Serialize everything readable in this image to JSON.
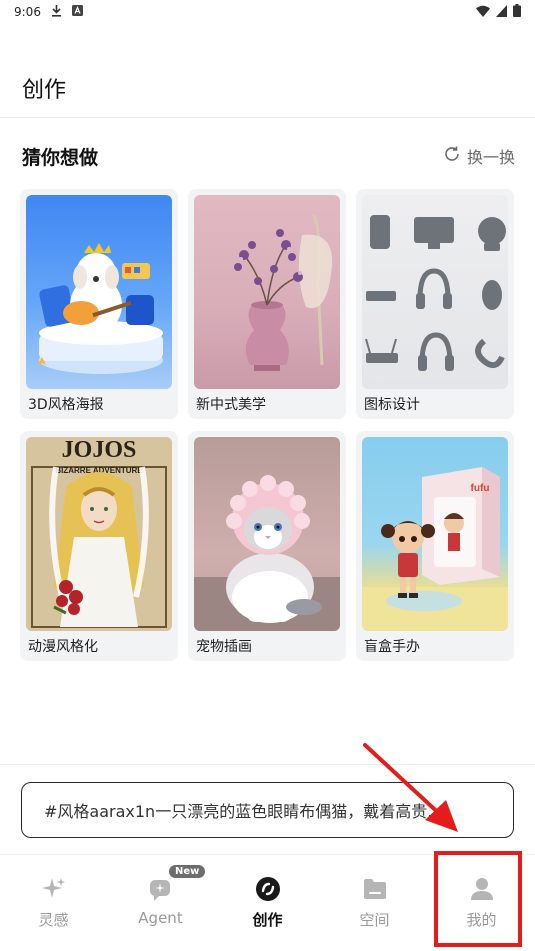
{
  "status_bar": {
    "time": "9:06"
  },
  "header": {
    "title": "创作"
  },
  "suggest": {
    "title": "猜你想做",
    "refresh_label": "换一换",
    "cards": [
      {
        "label": "3D风格海报"
      },
      {
        "label": "新中式美学"
      },
      {
        "label": "图标设计"
      },
      {
        "label": "动漫风格化"
      },
      {
        "label": "宠物插画"
      },
      {
        "label": "盲盒手办"
      }
    ],
    "poster_text": {
      "title": "JOJOS",
      "subtitle": "BIZARRE ADVENTURE",
      "box_brand": "fufu"
    }
  },
  "prompt": {
    "text": "#风格aarax1n一只漂亮的蓝色眼睛布偶猫，戴着高贵..."
  },
  "tabbar": {
    "items": [
      {
        "label": "灵感",
        "icon": "sparkle-icon"
      },
      {
        "label": "Agent",
        "icon": "agent-icon",
        "badge": "New"
      },
      {
        "label": "创作",
        "icon": "create-icon",
        "active": true
      },
      {
        "label": "空间",
        "icon": "folder-icon"
      },
      {
        "label": "我的",
        "icon": "person-icon"
      }
    ]
  },
  "colors": {
    "annotation": "#e51c1c",
    "text_primary": "#111111",
    "text_muted": "#9a9a9a"
  }
}
